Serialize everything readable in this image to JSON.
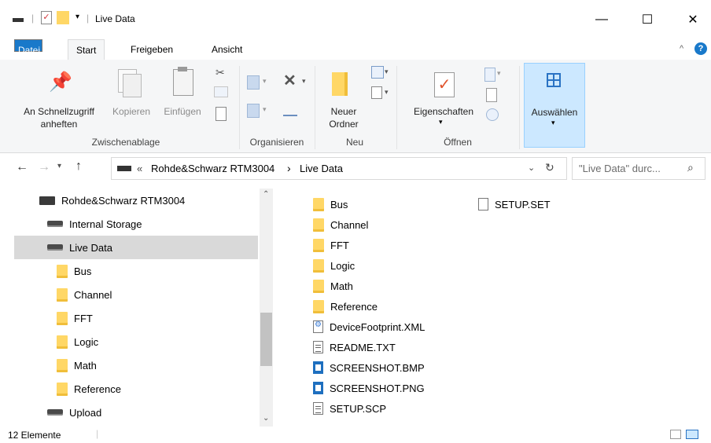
{
  "window": {
    "title": "Live Data",
    "minimize_glyph": "—",
    "maximize_glyph": "☐",
    "close_glyph": "✕"
  },
  "ribbon_tabs": [
    "Datei",
    "Start",
    "Freigeben",
    "Ansicht"
  ],
  "ribbon": {
    "pin_label_1": "An Schnellzugriff",
    "pin_label_2": "anheften",
    "copy_label": "Kopieren",
    "paste_label": "Einfügen",
    "group_clipboard": "Zwischenablage",
    "group_organize": "Organisieren",
    "new_folder_1": "Neuer",
    "new_folder_2": "Ordner",
    "group_new": "Neu",
    "properties_label": "Eigenschaften",
    "group_open": "Öffnen",
    "select_label": "Auswählen"
  },
  "address": {
    "crumb_sep": "«",
    "crumb_1": "Rohde&Schwarz RTM3004",
    "crumb_arrow": "›",
    "crumb_2": "Live Data",
    "search_placeholder": "\"Live Data\" durc..."
  },
  "nav": {
    "device": "Rohde&Schwarz RTM3004",
    "internal": "Internal Storage",
    "live": "Live Data",
    "folders": [
      "Bus",
      "Channel",
      "FFT",
      "Logic",
      "Math",
      "Reference"
    ],
    "upload": "Upload"
  },
  "files_col1": [
    {
      "name": "Bus",
      "kind": "folder"
    },
    {
      "name": "Channel",
      "kind": "folder"
    },
    {
      "name": "FFT",
      "kind": "folder"
    },
    {
      "name": "Logic",
      "kind": "folder"
    },
    {
      "name": "Math",
      "kind": "folder"
    },
    {
      "name": "Reference",
      "kind": "folder"
    },
    {
      "name": "DeviceFootprint.XML",
      "kind": "xml"
    },
    {
      "name": "README.TXT",
      "kind": "txt"
    },
    {
      "name": "SCREENSHOT.BMP",
      "kind": "img"
    },
    {
      "name": "SCREENSHOT.PNG",
      "kind": "img"
    },
    {
      "name": "SETUP.SCP",
      "kind": "txt"
    }
  ],
  "files_col2": [
    {
      "name": "SETUP.SET",
      "kind": "blank"
    }
  ],
  "status": {
    "count": "12 Elemente"
  }
}
